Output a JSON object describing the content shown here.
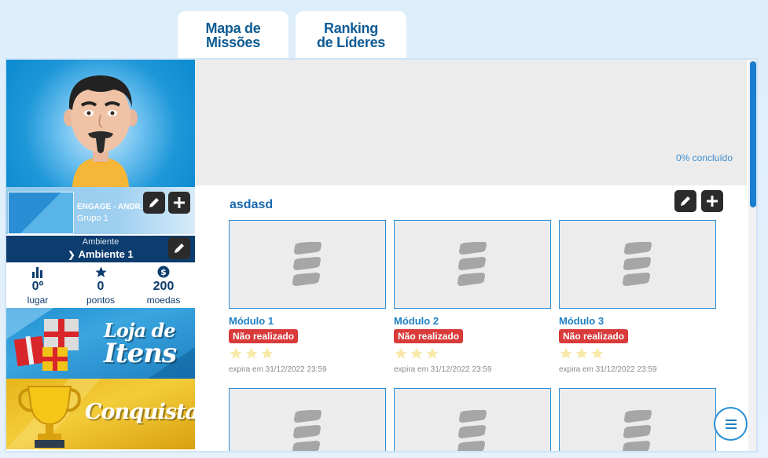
{
  "tabs": [
    {
      "line1": "Mapa de",
      "line2": "Missões"
    },
    {
      "line1": "Ranking",
      "line2": "de Líderes"
    }
  ],
  "team": {
    "name": "ENGAGE - ANDR...",
    "group": "Grupo 1"
  },
  "environment": {
    "label": "Ambiente",
    "value": "Ambiente 1"
  },
  "stats": [
    {
      "value": "0º",
      "label": "lugar",
      "icon": "bar-chart-icon"
    },
    {
      "value": "0",
      "label": "pontos",
      "icon": "star-icon"
    },
    {
      "value": "200",
      "label": "moedas",
      "icon": "coin-icon"
    }
  ],
  "banners": {
    "store_line1": "Loja de",
    "store_line2": "Itens",
    "achievements": "Conquistas"
  },
  "progress": {
    "text": "0% concluído",
    "value": 0
  },
  "section": {
    "title": "asdasd"
  },
  "modules": [
    {
      "title": "Módulo 1",
      "status": "Não realizado",
      "expiry": "expira em 31/12/2022 23:59",
      "stars": 0
    },
    {
      "title": "Módulo 2",
      "status": "Não realizado",
      "expiry": "expira em 31/12/2022 23:59",
      "stars": 0
    },
    {
      "title": "Módulo 3",
      "status": "Não realizado",
      "expiry": "expira em 31/12/2022 23:59",
      "stars": 0
    }
  ],
  "colors": {
    "accent": "#1e7fc4",
    "navy": "#0d3c6e",
    "danger": "#d93a3a",
    "star_empty": "#f7e9a8"
  }
}
